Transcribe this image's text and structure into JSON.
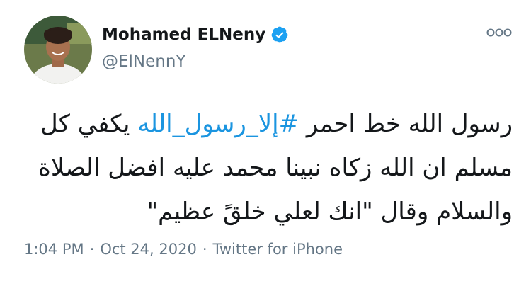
{
  "user": {
    "display_name": "Mohamed ELNeny",
    "handle": "@ElNennY",
    "verified": true
  },
  "tweet": {
    "text_before": "رسول الله خط احمر ",
    "hashtag": "#إلا_رسول_الله",
    "text_after": " يكفي كل مسلم ان الله زكاه نبينا محمد عليه افضل الصلاة والسلام وقال \"انك لعلي خلقً عظيم\""
  },
  "meta": {
    "time": "1:04 PM",
    "separator": "·",
    "date": "Oct 24, 2020",
    "source": "Twitter for iPhone"
  },
  "colors": {
    "link": "#1b95e0",
    "verified_badge": "#1da1f2",
    "secondary_text": "#657786"
  },
  "icons": {
    "verified": "verified-badge-icon",
    "more": "more-options-icon"
  }
}
